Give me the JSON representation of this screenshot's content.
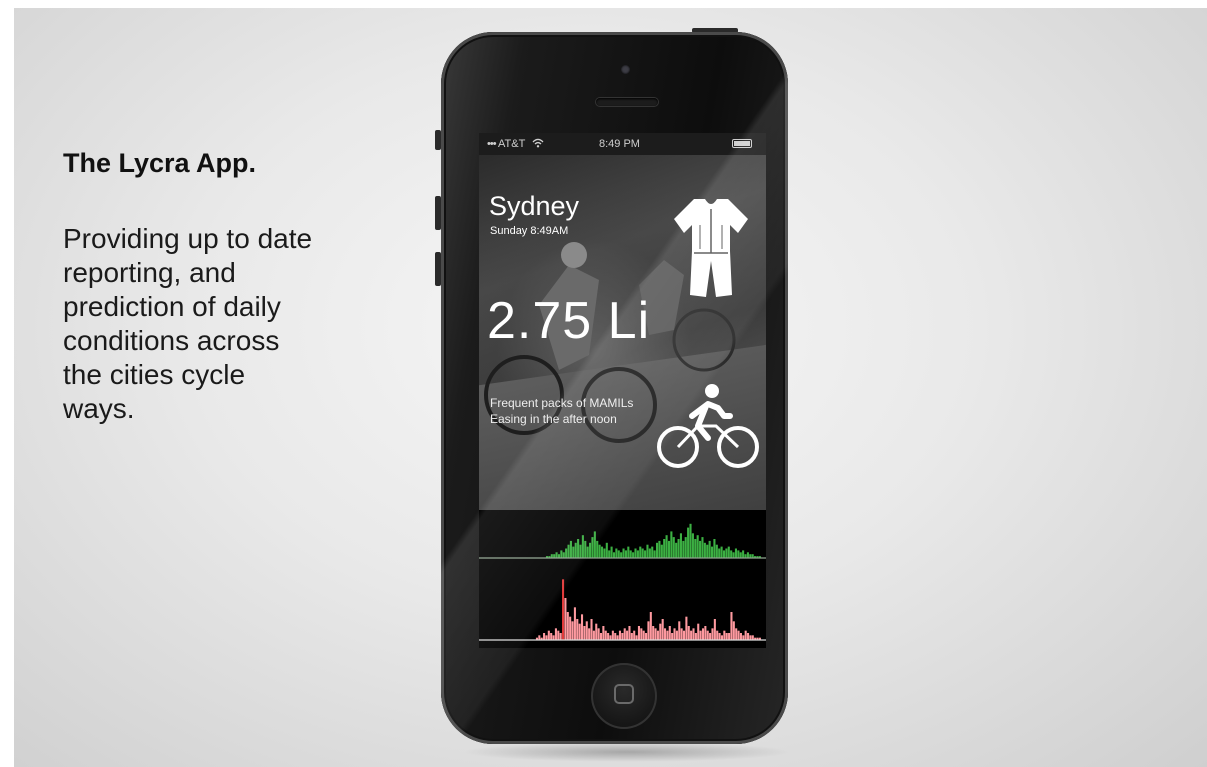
{
  "slide": {
    "headline": "The Lycra App.",
    "description_lines": [
      "Providing up to date",
      "reporting, and",
      "prediction of daily",
      "conditions across",
      "the cities cycle",
      "ways."
    ]
  },
  "status_bar": {
    "carrier": "AT&T",
    "time": "8:49 PM"
  },
  "app": {
    "city": "Sydney",
    "datetime": "Sunday 8:49AM",
    "index_value": "2.75 Li",
    "conditions": [
      "Frequent packs of MAMILs",
      "Easing in the after noon"
    ],
    "icons": {
      "kit": "cycling-jersey-icon",
      "bike": "cyclist-icon",
      "wifi": "wifi-icon",
      "battery": "battery-icon"
    }
  },
  "chart_data": [
    {
      "type": "bar",
      "color": "#3cb043",
      "values": [
        0,
        0,
        0,
        0,
        0,
        0,
        0,
        0,
        0,
        0,
        0,
        0,
        0,
        0,
        0,
        0,
        0,
        0,
        0,
        0,
        0,
        0,
        0,
        0,
        0,
        0,
        0,
        0,
        1,
        1,
        2,
        2,
        3,
        2,
        4,
        3,
        5,
        7,
        9,
        6,
        8,
        10,
        7,
        12,
        9,
        6,
        8,
        11,
        14,
        9,
        7,
        6,
        5,
        8,
        4,
        6,
        3,
        5,
        4,
        3,
        5,
        4,
        6,
        4,
        3,
        5,
        4,
        6,
        5,
        4,
        7,
        5,
        6,
        4,
        8,
        9,
        7,
        10,
        12,
        9,
        14,
        11,
        8,
        10,
        13,
        9,
        11,
        16,
        18,
        13,
        10,
        12,
        9,
        11,
        8,
        7,
        9,
        6,
        10,
        7,
        5,
        6,
        4,
        5,
        6,
        4,
        3,
        5,
        4,
        3,
        4,
        2,
        3,
        2,
        2,
        1,
        1,
        1,
        0,
        0
      ],
      "ylim": [
        0,
        20
      ]
    },
    {
      "type": "bar",
      "color": "#ff9aa0",
      "highlight_color": "#e33b3b",
      "values": [
        0,
        0,
        0,
        0,
        0,
        0,
        0,
        0,
        0,
        0,
        0,
        0,
        0,
        0,
        0,
        0,
        0,
        0,
        0,
        0,
        0,
        0,
        0,
        0,
        1,
        2,
        1,
        3,
        2,
        4,
        3,
        2,
        5,
        4,
        3,
        26,
        18,
        12,
        10,
        8,
        14,
        9,
        7,
        11,
        6,
        8,
        5,
        9,
        4,
        7,
        5,
        3,
        6,
        4,
        3,
        2,
        4,
        3,
        2,
        4,
        3,
        5,
        4,
        6,
        3,
        4,
        2,
        6,
        5,
        4,
        3,
        8,
        12,
        6,
        5,
        4,
        7,
        9,
        5,
        4,
        6,
        3,
        5,
        4,
        8,
        5,
        4,
        10,
        6,
        4,
        5,
        3,
        7,
        4,
        5,
        6,
        4,
        3,
        5,
        9,
        4,
        3,
        2,
        4,
        3,
        3,
        12,
        8,
        5,
        4,
        3,
        2,
        4,
        3,
        2,
        2,
        1,
        1,
        1,
        0,
        0
      ],
      "ylim": [
        0,
        30
      ]
    }
  ]
}
